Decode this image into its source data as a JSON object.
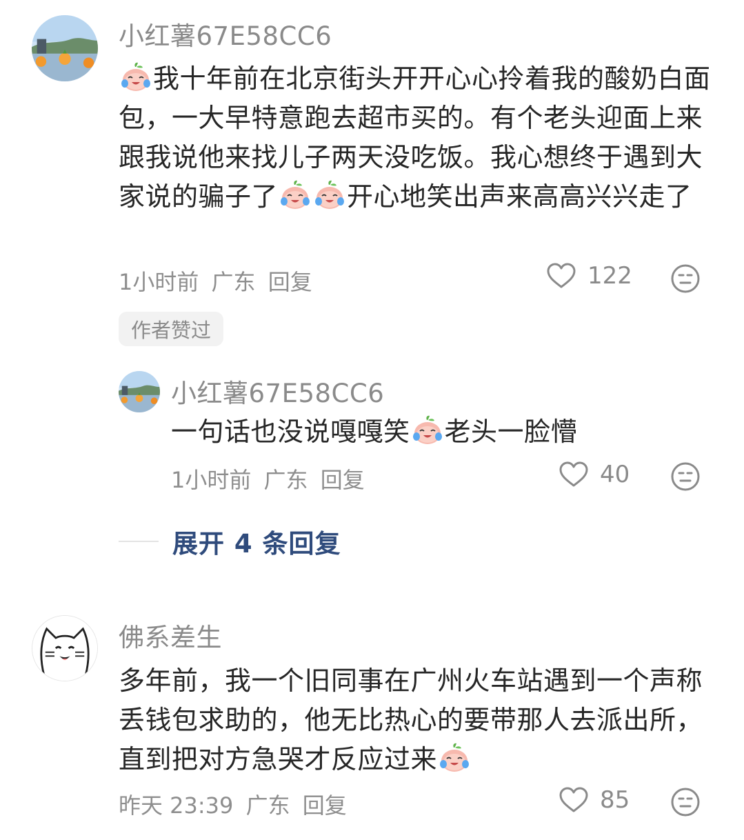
{
  "comments": [
    {
      "username": "小红薯67E58CC6",
      "text_segments": [
        "我十年前在北京街头开开心心拎着我的酸奶白面包，一大早特意跑去超市买的。有个老头迎面上来跟我说他来找儿子两天没吃饭。我心想终于遇到大家说的骗子了",
        "开心地笑出声来高高兴兴走了"
      ],
      "time": "1小时前",
      "location": "广东",
      "reply_label": "回复",
      "likes": "122",
      "badge": "作者赞过",
      "reply": {
        "username": "小红薯67E58CC6",
        "text_segments": [
          "一句话也没说嘎嘎笑",
          "老头一脸懵"
        ],
        "time": "1小时前",
        "location": "广东",
        "reply_label": "回复",
        "likes": "40"
      },
      "expand_label": "展开 4 条回复"
    },
    {
      "username": "佛系差生",
      "text_segments": [
        "多年前，我一个旧同事在广州火车站遇到一个声称丢钱包求助的，他无比热心的要带那人去派出所，直到把对方急哭才反应过来"
      ],
      "time": "昨天 23:39",
      "location": "广东",
      "reply_label": "回复",
      "likes": "85"
    }
  ],
  "icons": {
    "emoji": "crying-laughing-peach-icon",
    "like": "heart-outline-icon",
    "dislike": "meh-face-icon"
  },
  "colors": {
    "link": "#2f4b7c",
    "meta": "#8e8e8e",
    "text": "#262626"
  }
}
